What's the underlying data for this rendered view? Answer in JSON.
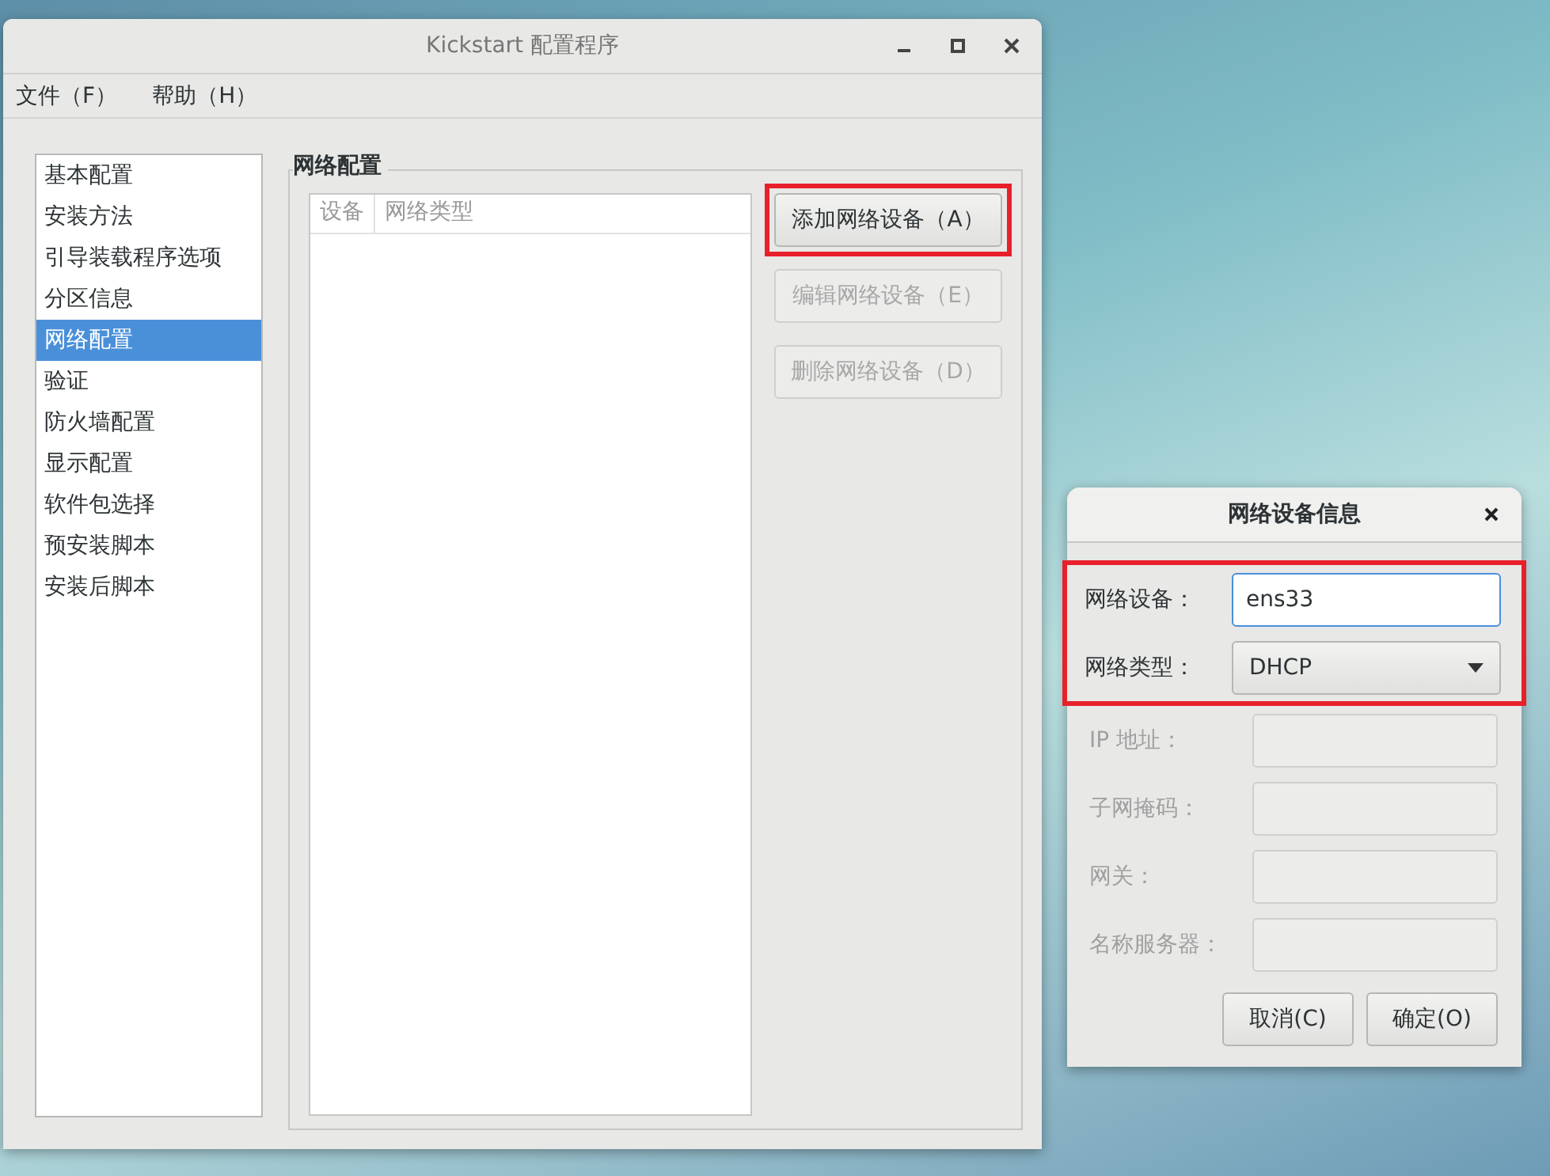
{
  "main_window": {
    "title": "Kickstart 配置程序",
    "menu": [
      "文件（F）",
      "帮助（H）"
    ],
    "sidebar": {
      "items": [
        {
          "label": "基本配置",
          "selected": false
        },
        {
          "label": "安装方法",
          "selected": false
        },
        {
          "label": "引导装载程序选项",
          "selected": false
        },
        {
          "label": "分区信息",
          "selected": false
        },
        {
          "label": "网络配置",
          "selected": true
        },
        {
          "label": "验证",
          "selected": false
        },
        {
          "label": "防火墙配置",
          "selected": false
        },
        {
          "label": "显示配置",
          "selected": false
        },
        {
          "label": "软件包选择",
          "selected": false
        },
        {
          "label": "预安装脚本",
          "selected": false
        },
        {
          "label": "安装后脚本",
          "selected": false
        }
      ]
    },
    "section_title": "网络配置",
    "table": {
      "columns": [
        "设备",
        "网络类型"
      ]
    },
    "buttons": [
      {
        "label": "添加网络设备（A）",
        "disabled": false,
        "highlighted": true
      },
      {
        "label": "编辑网络设备（E）",
        "disabled": true,
        "highlighted": false
      },
      {
        "label": "删除网络设备（D）",
        "disabled": true,
        "highlighted": false
      }
    ]
  },
  "dialog": {
    "title": "网络设备信息",
    "fields": [
      {
        "label": "网络设备：",
        "kind": "text",
        "value": "ens33",
        "disabled": false,
        "focused": true,
        "highlighted": true
      },
      {
        "label": "网络类型：",
        "kind": "select",
        "value": "DHCP",
        "disabled": false,
        "focused": false,
        "highlighted": true
      },
      {
        "label": "IP 地址：",
        "kind": "text",
        "disabled": true,
        "focused": false,
        "highlighted": false
      },
      {
        "label": "子网掩码：",
        "kind": "text",
        "disabled": true,
        "focused": false,
        "highlighted": false
      },
      {
        "label": "网关：",
        "kind": "text",
        "disabled": true,
        "focused": false,
        "highlighted": false
      },
      {
        "label": "名称服务器：",
        "kind": "text",
        "disabled": true,
        "focused": false,
        "highlighted": false
      }
    ],
    "buttons": [
      "取消(C)",
      "确定(O)"
    ]
  }
}
